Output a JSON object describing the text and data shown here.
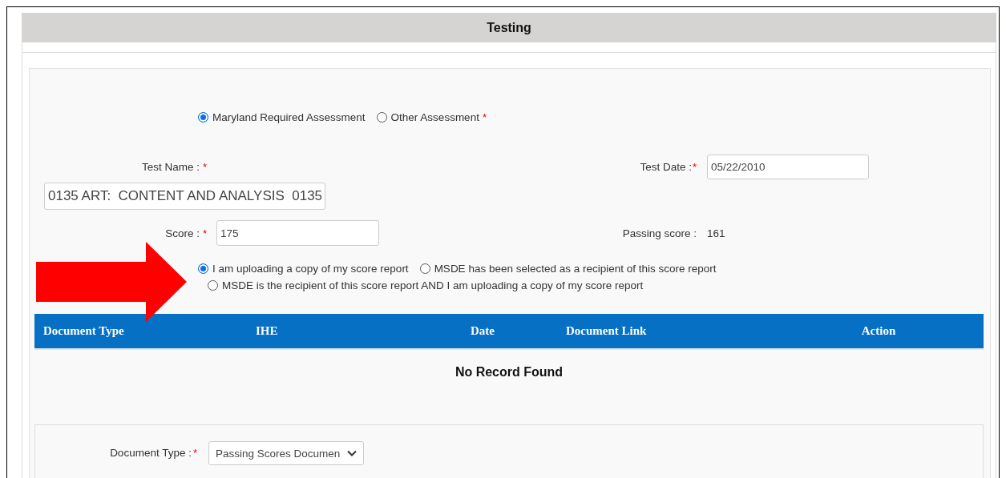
{
  "panel": {
    "title": "Testing"
  },
  "assessment": {
    "options": [
      {
        "label": "Maryland Required Assessment",
        "selected": true
      },
      {
        "label": "Other Assessment",
        "selected": false
      }
    ],
    "required_mark": "*"
  },
  "test_name": {
    "label": "Test Name :",
    "required_mark": "*",
    "value": "0135 ART:  CONTENT AND ANALYSIS  0135"
  },
  "test_date": {
    "label": "Test Date :",
    "required_mark": "*",
    "value": "05/22/2010"
  },
  "score": {
    "label": "Score :",
    "required_mark": "*",
    "value": "175"
  },
  "passing_score": {
    "label": "Passing score :",
    "value": "161"
  },
  "report_options": [
    {
      "label": "I am uploading a copy of my score report",
      "selected": true
    },
    {
      "label": "MSDE has been selected as a recipient of this score report",
      "selected": false
    },
    {
      "label": "MSDE is the recipient of this score report AND I am uploading a copy of my score report",
      "selected": false
    }
  ],
  "documents_table": {
    "columns": [
      "Document Type",
      "IHE",
      "Date",
      "Document Link",
      "Action"
    ],
    "empty_message": "No Record Found"
  },
  "document_type": {
    "label": "Document Type :",
    "required_mark": "*",
    "value": "Passing Scores Documen"
  }
}
